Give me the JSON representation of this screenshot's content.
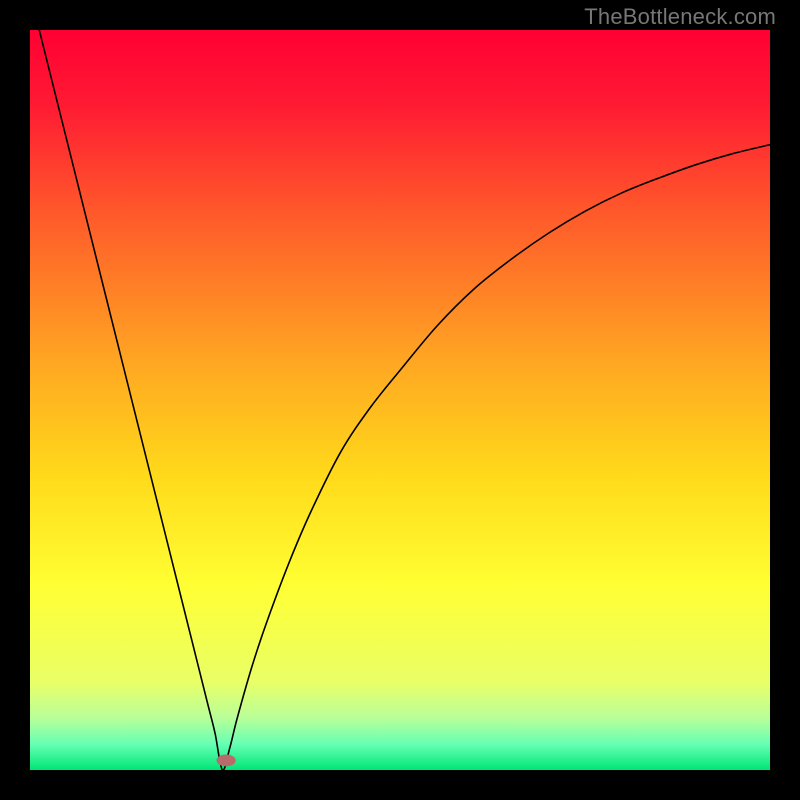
{
  "watermark": "TheBottleneck.com",
  "chart_data": {
    "type": "line",
    "title": "",
    "xlabel": "",
    "ylabel": "",
    "xlim": [
      0,
      100
    ],
    "ylim": [
      0,
      100
    ],
    "background_gradient": {
      "stops": [
        {
          "offset": 0.0,
          "color": "#ff0033"
        },
        {
          "offset": 0.1,
          "color": "#ff1a33"
        },
        {
          "offset": 0.25,
          "color": "#ff5a2a"
        },
        {
          "offset": 0.45,
          "color": "#ffa722"
        },
        {
          "offset": 0.6,
          "color": "#ffd91a"
        },
        {
          "offset": 0.75,
          "color": "#ffff33"
        },
        {
          "offset": 0.88,
          "color": "#eaff66"
        },
        {
          "offset": 0.93,
          "color": "#b8ff99"
        },
        {
          "offset": 0.965,
          "color": "#66ffb3"
        },
        {
          "offset": 1.0,
          "color": "#00e676"
        }
      ]
    },
    "curve_minimum": {
      "x": 26,
      "y": 0
    },
    "marker": {
      "x": 26.5,
      "y": 1.3,
      "color": "#b96b6b",
      "rx": 1.3,
      "ry": 0.8
    },
    "series": [
      {
        "name": "bottleneck-curve",
        "color": "#000000",
        "stroke_width": 1.6,
        "x": [
          0,
          2,
          4,
          6,
          8,
          10,
          12,
          14,
          16,
          18,
          20,
          22,
          24,
          25,
          26,
          27,
          28,
          30,
          32,
          35,
          38,
          42,
          46,
          50,
          55,
          60,
          65,
          70,
          75,
          80,
          85,
          90,
          95,
          100
        ],
        "y": [
          105,
          97,
          89,
          81,
          73,
          65,
          57,
          49,
          41,
          33,
          25,
          17,
          9,
          5,
          0,
          3,
          7,
          14,
          20,
          28,
          35,
          43,
          49,
          54,
          60,
          65,
          69,
          72.5,
          75.5,
          78,
          80,
          81.8,
          83.3,
          84.5
        ]
      }
    ]
  }
}
